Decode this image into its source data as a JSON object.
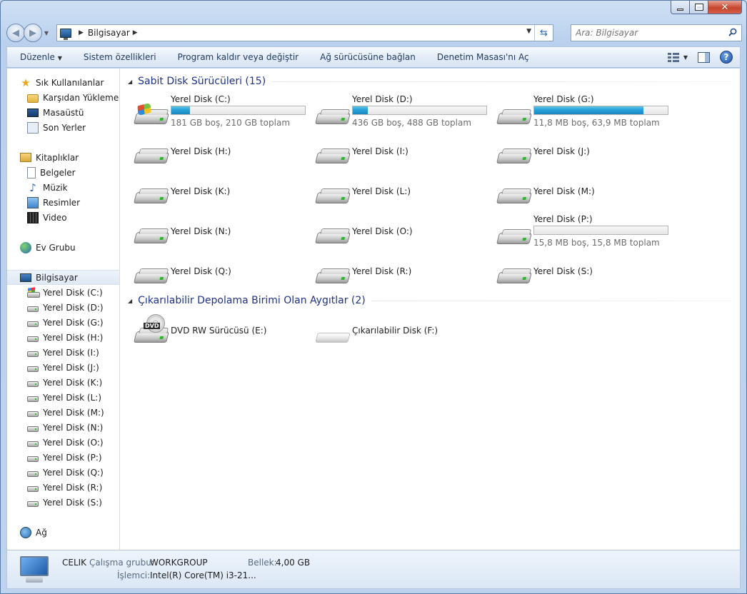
{
  "window": {
    "caption": {
      "minimize": "–",
      "maximize": "□",
      "close": "✕"
    }
  },
  "nav": {
    "back": "◀",
    "forward": "▶",
    "breadcrumb": [
      "Bilgisayar"
    ],
    "search_placeholder": "Ara: Bilgisayar"
  },
  "toolbar": {
    "items": [
      "Düzenle",
      "Sistem özellikleri",
      "Program kaldır veya değiştir",
      "Ağ sürücüsüne bağlan",
      "Denetim Masası'nı Aç"
    ],
    "help": "?"
  },
  "sidebar": {
    "favorites": {
      "label": "Sık Kullanılanlar",
      "items": [
        "Karşıdan Yüklemeler",
        "Masaüstü",
        "Son Yerler"
      ]
    },
    "libraries": {
      "label": "Kitaplıklar",
      "items": [
        "Belgeler",
        "Müzik",
        "Resimler",
        "Video"
      ]
    },
    "homegroup": {
      "label": "Ev Grubu"
    },
    "computer": {
      "label": "Bilgisayar",
      "items": [
        "Yerel Disk (C:)",
        "Yerel Disk (D:)",
        "Yerel Disk (G:)",
        "Yerel Disk (H:)",
        "Yerel Disk (I:)",
        "Yerel Disk (J:)",
        "Yerel Disk (K:)",
        "Yerel Disk (L:)",
        "Yerel Disk (M:)",
        "Yerel Disk (N:)",
        "Yerel Disk (O:)",
        "Yerel Disk (P:)",
        "Yerel Disk (Q:)",
        "Yerel Disk (R:)",
        "Yerel Disk (S:)"
      ]
    },
    "network": {
      "label": "Ağ"
    }
  },
  "main": {
    "hard_disks": {
      "title": "Sabit Disk Sürücüleri (15)",
      "drives": [
        {
          "name": "Yerel Disk (C:)",
          "info": "181 GB boş, 210 GB toplam",
          "used_fraction": 0.14,
          "system": true
        },
        {
          "name": "Yerel Disk (D:)",
          "info": "436 GB boş, 488 GB toplam",
          "used_fraction": 0.11
        },
        {
          "name": "Yerel Disk (G:)",
          "info": "11,8 MB boş, 63,9 MB toplam",
          "used_fraction": 0.82
        },
        {
          "name": "Yerel Disk (H:)"
        },
        {
          "name": "Yerel Disk (I:)"
        },
        {
          "name": "Yerel Disk (J:)"
        },
        {
          "name": "Yerel Disk (K:)"
        },
        {
          "name": "Yerel Disk (L:)"
        },
        {
          "name": "Yerel Disk (M:)"
        },
        {
          "name": "Yerel Disk (N:)"
        },
        {
          "name": "Yerel Disk (O:)"
        },
        {
          "name": "Yerel Disk (P:)",
          "info": "15,8 MB boş, 15,8 MB toplam",
          "used_fraction": 0.0
        },
        {
          "name": "Yerel Disk (Q:)"
        },
        {
          "name": "Yerel Disk (R:)"
        },
        {
          "name": "Yerel Disk (S:)"
        }
      ]
    },
    "removable": {
      "title": "Çıkarılabilir Depolama Birimi Olan Aygıtlar (2)",
      "devices": [
        {
          "name": "DVD RW Sürücüsü (E:)",
          "badge": "DVD",
          "icon": "dvd-drive-icon"
        },
        {
          "name": "Çıkarılabilir Disk (F:)",
          "icon": "removable-disk-icon"
        }
      ]
    }
  },
  "details": {
    "computer_name": "CELIK",
    "workgroup_label": "Çalışma grubu:",
    "workgroup_value": "WORKGROUP",
    "memory_label": "Bellek:",
    "memory_value": "4,00 GB",
    "cpu_label": "İşlemci:",
    "cpu_value": "Intel(R) Core(TM) i3-21..."
  },
  "colors": {
    "accent": "#1e3287",
    "bar_fill": "#26a0da",
    "window_frame": "#b9d1ee"
  }
}
